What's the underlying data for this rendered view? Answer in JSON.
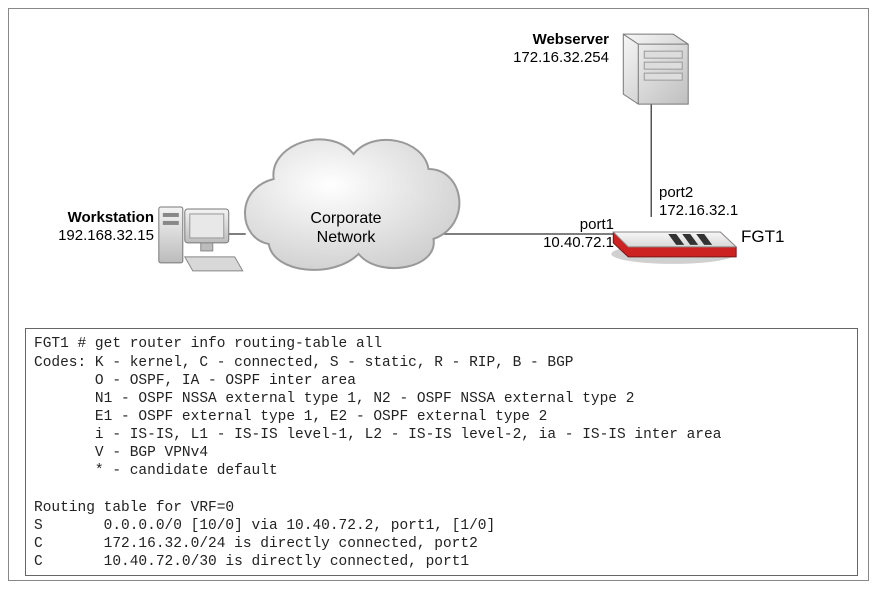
{
  "nodes": {
    "webserver": {
      "title": "Webserver",
      "ip": "172.16.32.254"
    },
    "workstation": {
      "title": "Workstation",
      "ip": "192.168.32.15"
    },
    "cloud": {
      "label1": "Corporate",
      "label2": "Network"
    },
    "fgt1": {
      "name": "FGT1",
      "port1": {
        "name": "port1",
        "ip": "10.40.72.1"
      },
      "port2": {
        "name": "port2",
        "ip": "172.16.32.1"
      }
    }
  },
  "terminal": {
    "prompt": "FGT1 # get router info routing-table all",
    "codes_line": "Codes: K - kernel, C - connected, S - static, R - RIP, B - BGP",
    "ospf_line": "       O - OSPF, IA - OSPF inter area",
    "nssa_line": "       N1 - OSPF NSSA external type 1, N2 - OSPF NSSA external type 2",
    "ext_line": "       E1 - OSPF external type 1, E2 - OSPF external type 2",
    "isis_line": "       i - IS-IS, L1 - IS-IS level-1, L2 - IS-IS level-2, ia - IS-IS inter area",
    "vpn_line": "       V - BGP VPNv4",
    "cand_line": "       * - candidate default",
    "blank": "",
    "vrf_line": "Routing table for VRF=0",
    "route_s": "S       0.0.0.0/0 [10/0] via 10.40.72.2, port1, [1/0]",
    "route_c1": "C       172.16.32.0/24 is directly connected, port2",
    "route_c2": "C       10.40.72.0/30 is directly connected, port1"
  }
}
